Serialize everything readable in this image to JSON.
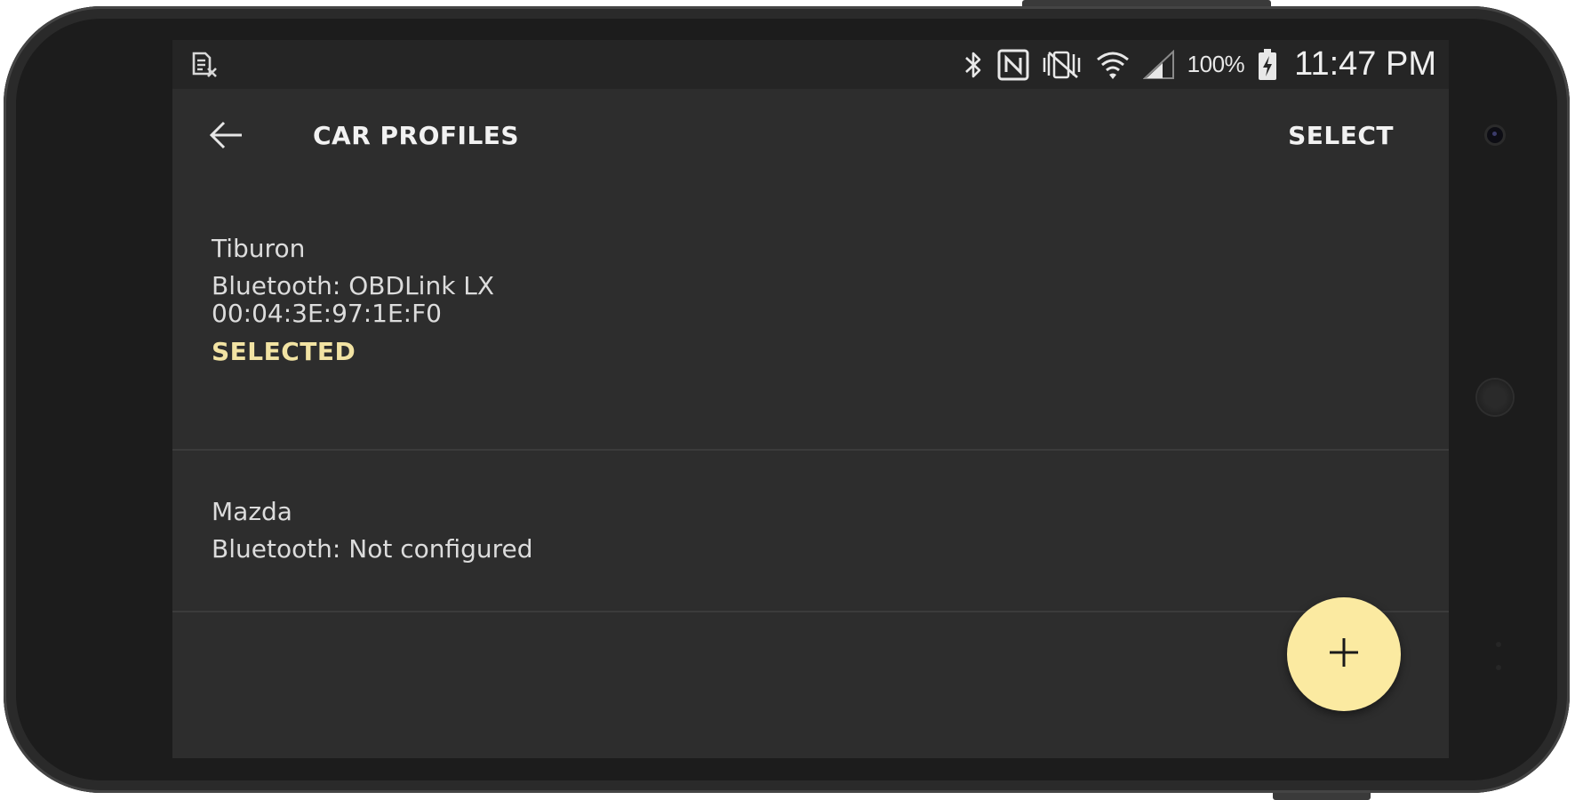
{
  "status_bar": {
    "left_icon": "notification-doc-icon",
    "icons": [
      "bluetooth-icon",
      "nfc-icon",
      "vibrate-mute-icon",
      "wifi-icon",
      "cell-signal-icon",
      "battery-charging-icon"
    ],
    "battery_percent": "100%",
    "time": "11:47 PM"
  },
  "app_bar": {
    "back_icon": "back-arrow-icon",
    "title": "CAR PROFILES",
    "action_label": "SELECT"
  },
  "profiles": [
    {
      "name": "Tiburon",
      "bluetooth": "Bluetooth: OBDLink LX",
      "address": "00:04:3E:97:1E:F0",
      "status": "SELECTED"
    },
    {
      "name": "Mazda",
      "bluetooth": "Bluetooth: Not configured"
    }
  ],
  "fab": {
    "icon": "plus-icon"
  },
  "colors": {
    "screen_background": "#2d2d2d",
    "status_bar_background": "#252525",
    "accent": "#fbeaa1",
    "selected_text": "#f2e3a3",
    "divider": "#3b3b3b",
    "device_body": "#1c1c1c"
  }
}
